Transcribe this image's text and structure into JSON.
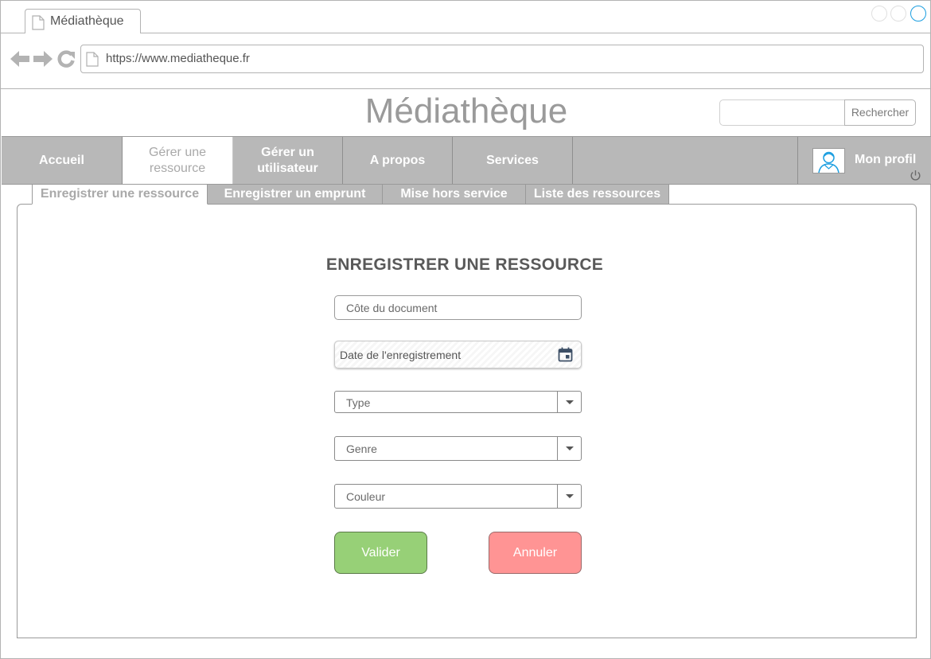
{
  "browser": {
    "tab_title": "Médiathèque",
    "url": "https://www.mediatheque.fr"
  },
  "header": {
    "site_title": "Médiathèque",
    "search_placeholder": "",
    "search_button": "Rechercher"
  },
  "nav": {
    "items": [
      {
        "label": "Accueil"
      },
      {
        "label": "Gérer une ressource"
      },
      {
        "label": "Gérer un utilisateur"
      },
      {
        "label": "A propos"
      },
      {
        "label": "Services"
      }
    ],
    "active_item": "Gérer une ressource",
    "profile_label": "Mon profil"
  },
  "subtabs": {
    "items": [
      {
        "label": "Enregistrer une ressource"
      },
      {
        "label": "Enregistrer un emprunt"
      },
      {
        "label": "Mise hors service"
      },
      {
        "label": "Liste des ressources"
      }
    ],
    "active_item": "Enregistrer une ressource"
  },
  "form": {
    "title": "ENREGISTRER UNE RESSOURCE",
    "cote_placeholder": "Côte du document",
    "date_placeholder": "Date de l'enregistrement",
    "type_placeholder": "Type",
    "genre_placeholder": "Genre",
    "couleur_placeholder": "Couleur",
    "valider_label": "Valider",
    "annuler_label": "Annuler"
  },
  "colors": {
    "nav_bg": "#b8b8b8",
    "valider_bg": "#97d077",
    "annuler_bg": "#ff9494",
    "window_active": "#1b9ee0"
  },
  "icons": [
    "document-icon",
    "back-arrow-icon",
    "forward-arrow-icon",
    "reload-icon",
    "calendar-icon",
    "chevron-down-icon",
    "user-avatar-icon",
    "power-icon"
  ]
}
